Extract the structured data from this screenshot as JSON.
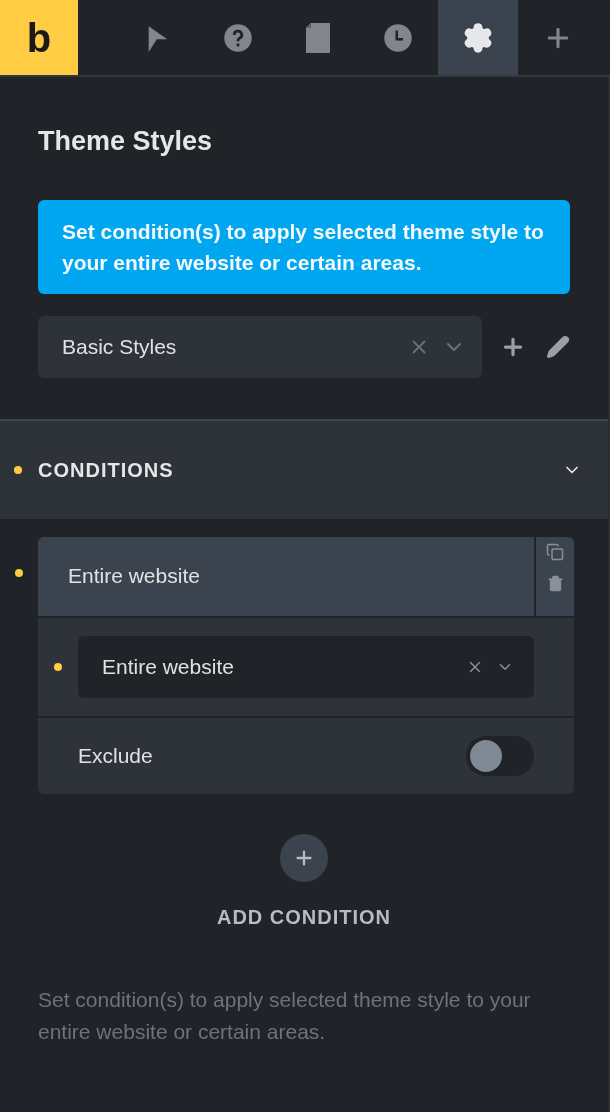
{
  "toolbar": {
    "logo": "b",
    "tabs": [
      {
        "kind": "cursor",
        "selected": false
      },
      {
        "kind": "help",
        "selected": false
      },
      {
        "kind": "page",
        "selected": false
      },
      {
        "kind": "history",
        "selected": false
      },
      {
        "kind": "settings",
        "selected": true
      },
      {
        "kind": "add",
        "selected": false
      }
    ]
  },
  "title": "Theme Styles",
  "notice": "Set condition(s) to apply selected theme style to your entire website or certain areas.",
  "style_select": {
    "value": "Basic Styles"
  },
  "conditions": {
    "label": "CONDITIONS",
    "expanded": true,
    "items": [
      {
        "title": "Entire website",
        "select_value": "Entire website",
        "exclude_label": "Exclude",
        "exclude_on": false
      }
    ],
    "add_label": "ADD CONDITION"
  },
  "description": "Set condition(s) to apply selected theme style to your entire website or certain areas."
}
